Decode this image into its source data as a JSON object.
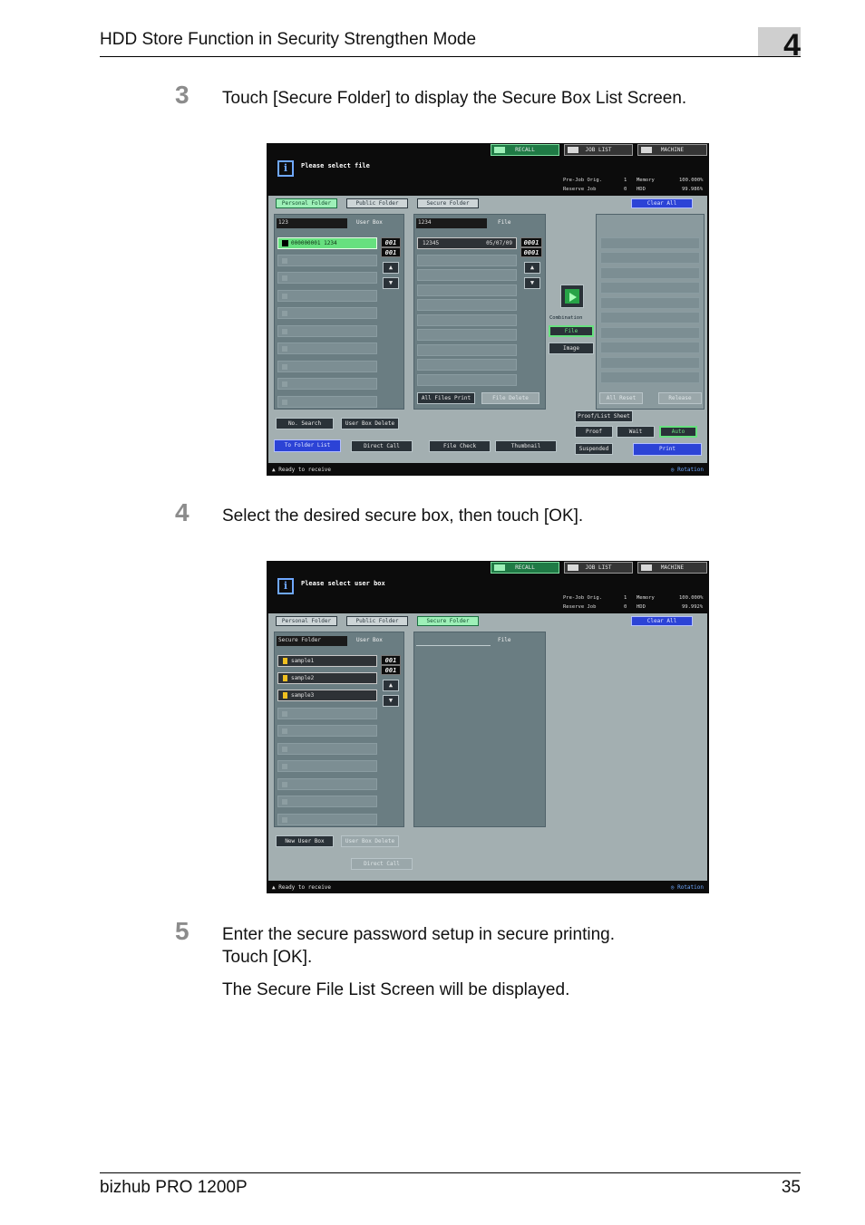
{
  "header": {
    "title": "HDD Store Function in Security Strengthen Mode",
    "chapter": "4"
  },
  "steps": [
    {
      "num": "3",
      "text": "Touch [Secure Folder] to display the Secure Box List Screen."
    },
    {
      "num": "4",
      "text": "Select the desired secure box, then touch [OK]."
    },
    {
      "num": "5",
      "line1": "Enter the secure password setup in secure printing.",
      "line2": "Touch [OK].",
      "note": "The Secure File List Screen will be displayed."
    }
  ],
  "footer": {
    "product": "bizhub PRO 1200P",
    "page": "35"
  },
  "screen1": {
    "header_buttons": {
      "recall": "RECALL",
      "job_list": "JOB LIST",
      "machine": "MACHINE"
    },
    "message": "Please select file",
    "status": {
      "pre_job": "Pre-Job Orig.",
      "pre_job_val": "1",
      "memory": "Memory",
      "memory_val": "100.000%",
      "reserve": "Reserve Job",
      "reserve_val": "0",
      "hdd": "HDD",
      "hdd_val": "99.986%"
    },
    "tabs": {
      "personal": "Personal Folder",
      "public": "Public Folder",
      "secure": "Secure Folder",
      "clear_all": "Clear All"
    },
    "userbox_field": "123",
    "userbox_label": "User Box",
    "selected_box": "000000001 1234",
    "count_top": "001",
    "count_bottom": "001",
    "file_field": "1234",
    "file_label": "File",
    "file_entry": "12345",
    "file_date": "05/07/09",
    "file_count_top": "0001",
    "file_count_bottom": "0001",
    "combination": "Combination",
    "file_btn": "File",
    "image_btn": "Image",
    "all_files_print": "All Files Print",
    "file_delete": "File Delete",
    "all_reset": "All Reset",
    "release": "Release",
    "no_search": "No. Search",
    "user_box_delete": "User Box Delete",
    "proof_list_sheet": "Proof/List Sheet",
    "to_folder_list": "To Folder List",
    "direct_call": "Direct Call",
    "file_check": "File Check",
    "thumbnail": "Thumbnail",
    "proof": "Proof",
    "wait": "Wait",
    "auto": "Auto",
    "suspended": "Suspended",
    "print": "Print",
    "ready": "Ready to receive",
    "rotation": "Rotation"
  },
  "screen2": {
    "header_buttons": {
      "recall": "RECALL",
      "job_list": "JOB LIST",
      "machine": "MACHINE"
    },
    "message": "Please select user box",
    "status": {
      "pre_job": "Pre-Job Orig.",
      "pre_job_val": "1",
      "memory": "Memory",
      "memory_val": "100.000%",
      "reserve": "Reserve Job",
      "reserve_val": "0",
      "hdd": "HDD",
      "hdd_val": "99.992%"
    },
    "tabs": {
      "personal": "Personal Folder",
      "public": "Public Folder",
      "secure": "Secure Folder",
      "clear_all": "Clear All"
    },
    "userbox_field": "Secure Folder",
    "userbox_label": "User Box",
    "boxes": [
      "sample1",
      "sample2",
      "sample3"
    ],
    "count_top": "001",
    "count_bottom": "001",
    "file_label": "File",
    "new_user_box": "New User Box",
    "user_box_delete": "User Box Delete",
    "direct_call": "Direct Call",
    "ready": "Ready to receive",
    "rotation": "Rotation"
  }
}
